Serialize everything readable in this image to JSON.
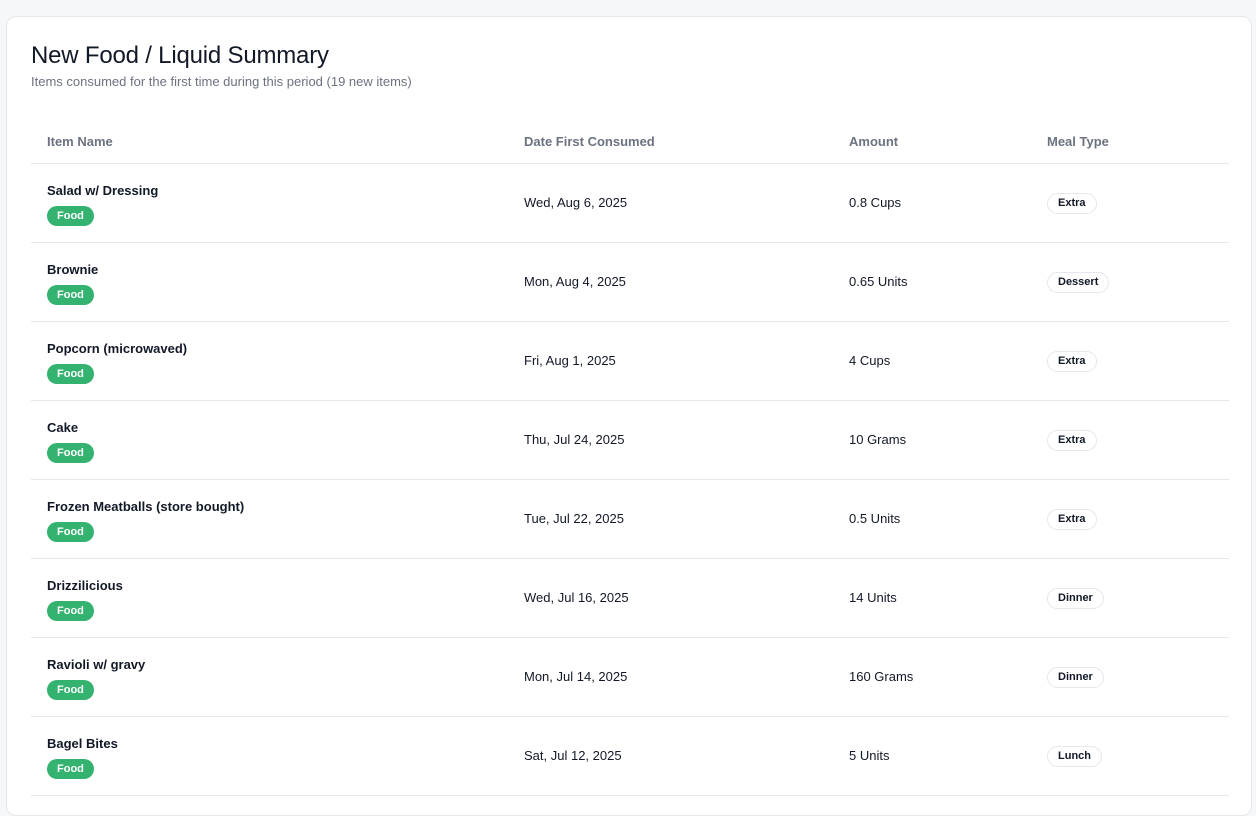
{
  "header": {
    "title": "New Food / Liquid Summary",
    "subtitle": "Items consumed for the first time during this period (19 new items)"
  },
  "table": {
    "columns": [
      "Item Name",
      "Date First Consumed",
      "Amount",
      "Meal Type"
    ],
    "rows": [
      {
        "name": "Salad w/ Dressing",
        "type": "Food",
        "date": "Wed, Aug 6, 2025",
        "amount": "0.8 Cups",
        "meal": "Extra"
      },
      {
        "name": "Brownie",
        "type": "Food",
        "date": "Mon, Aug 4, 2025",
        "amount": "0.65 Units",
        "meal": "Dessert"
      },
      {
        "name": "Popcorn (microwaved)",
        "type": "Food",
        "date": "Fri, Aug 1, 2025",
        "amount": "4 Cups",
        "meal": "Extra"
      },
      {
        "name": "Cake",
        "type": "Food",
        "date": "Thu, Jul 24, 2025",
        "amount": "10 Grams",
        "meal": "Extra"
      },
      {
        "name": "Frozen Meatballs (store bought)",
        "type": "Food",
        "date": "Tue, Jul 22, 2025",
        "amount": "0.5 Units",
        "meal": "Extra"
      },
      {
        "name": "Drizzilicious",
        "type": "Food",
        "date": "Wed, Jul 16, 2025",
        "amount": "14 Units",
        "meal": "Dinner"
      },
      {
        "name": "Ravioli w/ gravy",
        "type": "Food",
        "date": "Mon, Jul 14, 2025",
        "amount": "160 Grams",
        "meal": "Dinner"
      },
      {
        "name": "Bagel Bites",
        "type": "Food",
        "date": "Sat, Jul 12, 2025",
        "amount": "5 Units",
        "meal": "Lunch"
      }
    ]
  },
  "colors": {
    "food_badge": "#34b26f",
    "border": "#e5e7eb",
    "muted_text": "#6b7280"
  }
}
